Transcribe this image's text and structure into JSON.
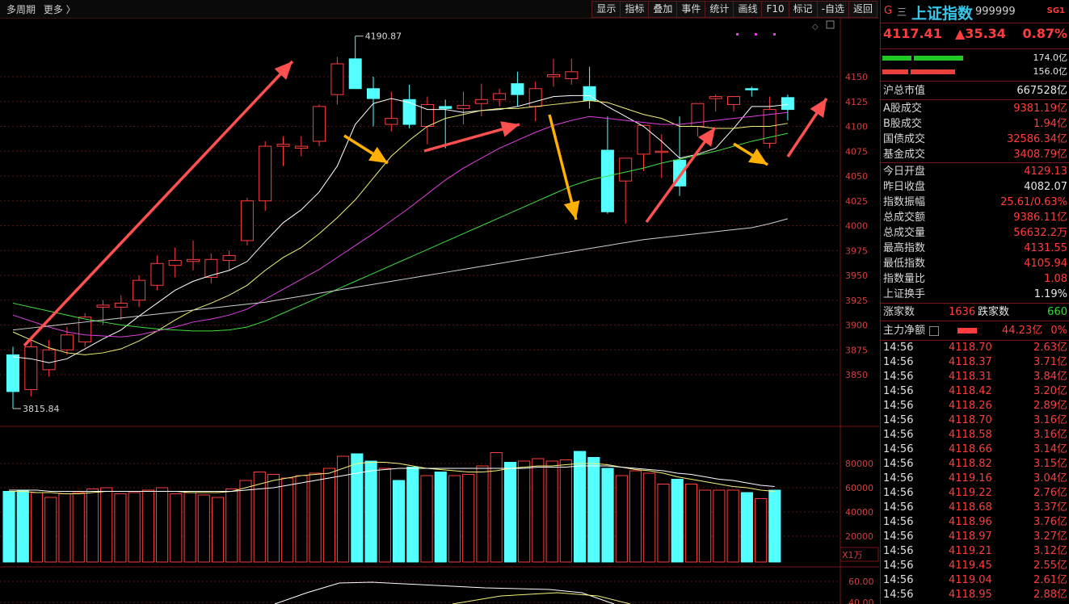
{
  "topbar": {
    "period": [
      "多周期",
      "更多 〉"
    ],
    "toolbar": [
      "显示",
      "指标",
      "叠加",
      "事件",
      "统计",
      "画线",
      "F10",
      "标记",
      "-自选",
      "返回"
    ]
  },
  "colors": {
    "up": "#ff3d3d",
    "down": "#54ffff",
    "ma5": "#ffffff",
    "ma10": "#f2f27a",
    "ma20": "#e040e0",
    "ma60": "#40e040",
    "ma120": "#d0d0d0",
    "arrow_red": "#ff5050",
    "arrow_yellow": "#ffb000"
  },
  "chart_data": [
    {
      "type": "candlestick",
      "ylim": [
        3815,
        4210
      ],
      "yticks": [
        3850,
        3875,
        3900,
        3925,
        3950,
        3975,
        4000,
        4025,
        4050,
        4075,
        4100,
        4125,
        4150
      ],
      "annotations": [
        {
          "label": "4190.87",
          "value": 4190.87,
          "bar": 19
        },
        {
          "label": "3815.84",
          "value": 3815.84,
          "bar": 0
        }
      ],
      "candles": [
        {
          "o": 3870,
          "h": 3878,
          "l": 3815.84,
          "c": 3833
        },
        {
          "o": 3835,
          "h": 3888,
          "l": 3828,
          "c": 3878
        },
        {
          "o": 3855,
          "h": 3885,
          "l": 3848,
          "c": 3875
        },
        {
          "o": 3875,
          "h": 3898,
          "l": 3870,
          "c": 3890
        },
        {
          "o": 3883,
          "h": 3912,
          "l": 3878,
          "c": 3908
        },
        {
          "o": 3918,
          "h": 3925,
          "l": 3900,
          "c": 3920
        },
        {
          "o": 3918,
          "h": 3930,
          "l": 3905,
          "c": 3922
        },
        {
          "o": 3925,
          "h": 3950,
          "l": 3918,
          "c": 3945
        },
        {
          "o": 3940,
          "h": 3970,
          "l": 3935,
          "c": 3962
        },
        {
          "o": 3960,
          "h": 3978,
          "l": 3948,
          "c": 3965
        },
        {
          "o": 3964,
          "h": 3985,
          "l": 3955,
          "c": 3966
        },
        {
          "o": 3948,
          "h": 3972,
          "l": 3942,
          "c": 3966
        },
        {
          "o": 3965,
          "h": 3975,
          "l": 3955,
          "c": 3970
        },
        {
          "o": 3985,
          "h": 4028,
          "l": 3980,
          "c": 4025
        },
        {
          "o": 4025,
          "h": 4085,
          "l": 4015,
          "c": 4080
        },
        {
          "o": 4080,
          "h": 4090,
          "l": 4060,
          "c": 4082
        },
        {
          "o": 4078,
          "h": 4090,
          "l": 4070,
          "c": 4080
        },
        {
          "o": 4085,
          "h": 4122,
          "l": 4080,
          "c": 4120
        },
        {
          "o": 4132,
          "h": 4170,
          "l": 4122,
          "c": 4163
        },
        {
          "o": 4168,
          "h": 4190.87,
          "l": 4140,
          "c": 4138
        },
        {
          "o": 4138,
          "h": 4150,
          "l": 4100,
          "c": 4128
        },
        {
          "o": 4102,
          "h": 4135,
          "l": 4095,
          "c": 4108
        },
        {
          "o": 4127,
          "h": 4142,
          "l": 4098,
          "c": 4102
        },
        {
          "o": 4100,
          "h": 4130,
          "l": 4082,
          "c": 4122
        },
        {
          "o": 4120,
          "h": 4127,
          "l": 4078,
          "c": 4118
        },
        {
          "o": 4118,
          "h": 4135,
          "l": 4102,
          "c": 4121
        },
        {
          "o": 4123,
          "h": 4143,
          "l": 4110,
          "c": 4127
        },
        {
          "o": 4127,
          "h": 4138,
          "l": 4120,
          "c": 4133
        },
        {
          "o": 4143,
          "h": 4155,
          "l": 4120,
          "c": 4132
        },
        {
          "o": 4120,
          "h": 4145,
          "l": 4105,
          "c": 4138
        },
        {
          "o": 4150,
          "h": 4168,
          "l": 4140,
          "c": 4152
        },
        {
          "o": 4148,
          "h": 4168,
          "l": 4142,
          "c": 4155
        },
        {
          "o": 4140,
          "h": 4160,
          "l": 4118,
          "c": 4126
        },
        {
          "o": 4076,
          "h": 4110,
          "l": 4012,
          "c": 4014
        },
        {
          "o": 4045,
          "h": 4068,
          "l": 4002,
          "c": 4068
        },
        {
          "o": 4072,
          "h": 4098,
          "l": 4055,
          "c": 4101
        },
        {
          "o": 4075,
          "h": 4092,
          "l": 4048,
          "c": 4075
        },
        {
          "o": 4066,
          "h": 4110,
          "l": 4030,
          "c": 4040
        },
        {
          "o": 4100,
          "h": 4123,
          "l": 4090,
          "c": 4123
        },
        {
          "o": 4128,
          "h": 4132,
          "l": 4115,
          "c": 4130
        },
        {
          "o": 4122,
          "h": 4130,
          "l": 4115,
          "c": 4130
        },
        {
          "o": 4138,
          "h": 4140,
          "l": 4130,
          "c": 4137
        },
        {
          "o": 4083,
          "h": 4130,
          "l": 4078,
          "c": 4117
        },
        {
          "o": 4129,
          "h": 4132,
          "l": 4106,
          "c": 4117
        }
      ],
      "ma": {
        "ma5": [
          3868,
          3866,
          3862,
          3866,
          3876,
          3886,
          3895,
          3909,
          3922,
          3935,
          3944,
          3950,
          3955,
          3964,
          3984,
          4003,
          4016,
          4034,
          4060,
          4102,
          4123,
          4128,
          4124,
          4117,
          4117,
          4114,
          4116,
          4117,
          4120,
          4125,
          4130,
          4131,
          4131,
          4120,
          4110,
          4100,
          4085,
          4068,
          4072,
          4078,
          4098,
          4120,
          4120,
          4122
        ],
        "ma10": [
          3893,
          3885,
          3877,
          3872,
          3870,
          3872,
          3876,
          3884,
          3894,
          3905,
          3915,
          3922,
          3930,
          3940,
          3955,
          3968,
          3978,
          3992,
          4008,
          4026,
          4048,
          4070,
          4086,
          4100,
          4108,
          4112,
          4116,
          4118,
          4118,
          4120,
          4122,
          4124,
          4126,
          4124,
          4118,
          4112,
          4108,
          4100,
          4100,
          4098,
          4098,
          4100,
          4100,
          4103
        ],
        "ma20": [
          3910,
          3904,
          3898,
          3893,
          3890,
          3889,
          3888,
          3890,
          3894,
          3898,
          3903,
          3906,
          3910,
          3916,
          3926,
          3936,
          3946,
          3956,
          3968,
          3980,
          3992,
          4005,
          4018,
          4032,
          4046,
          4058,
          4068,
          4078,
          4086,
          4094,
          4101,
          4106,
          4110,
          4108,
          4106,
          4104,
          4102,
          4102,
          4104,
          4106,
          4108,
          4110,
          4112,
          4114
        ],
        "ma60": [
          3922,
          3918,
          3914,
          3910,
          3906,
          3903,
          3900,
          3898,
          3896,
          3895,
          3894,
          3894,
          3895,
          3898,
          3904,
          3912,
          3920,
          3928,
          3936,
          3944,
          3952,
          3960,
          3968,
          3976,
          3984,
          3992,
          4000,
          4008,
          4016,
          4024,
          4032,
          4040,
          4046,
          4050,
          4054,
          4058,
          4063,
          4067,
          4071,
          4075,
          4080,
          4085,
          4089,
          4093
        ],
        "ma120": [
          3895,
          3897,
          3899,
          3901,
          3903,
          3905,
          3907,
          3909,
          3911,
          3913,
          3915,
          3917,
          3919,
          3921,
          3923,
          3926,
          3929,
          3932,
          3935,
          3938,
          3941,
          3944,
          3947,
          3950,
          3953,
          3956,
          3959,
          3962,
          3965,
          3968,
          3971,
          3974,
          3977,
          3980,
          3983,
          3986,
          3988,
          3990,
          3992,
          3994,
          3996,
          3998,
          4002,
          4007
        ]
      }
    },
    {
      "type": "bar",
      "name": "volume",
      "unit": "X1万",
      "ylim": [
        0,
        100000
      ],
      "yticks": [
        20000,
        40000,
        60000,
        80000
      ],
      "values": [
        57000,
        58000,
        56000,
        52000,
        55000,
        56000,
        59000,
        60000,
        55000,
        56000,
        58000,
        60000,
        55000,
        56000,
        54000,
        52000,
        59000,
        66000,
        73000,
        71000,
        68000,
        70000,
        72000,
        76000,
        86000,
        88000,
        82000,
        76000,
        66000,
        77000,
        70000,
        73000,
        70000,
        71000,
        78000,
        89000,
        81000,
        82000,
        84000,
        82000,
        83000,
        90000,
        85000,
        76000,
        70000,
        74000,
        72000,
        63000,
        67000,
        63000,
        58000,
        58000,
        58000,
        56000,
        51000,
        58000
      ],
      "ma1": [
        57000,
        57000,
        56000,
        56000,
        55000,
        55000,
        56000,
        57000,
        57000,
        57000,
        57000,
        57000,
        57000,
        56000,
        56000,
        56000,
        57000,
        60000,
        63000,
        66000,
        68000,
        70000,
        71000,
        72000,
        76000,
        80000,
        81000,
        81000,
        80000,
        78000,
        76000,
        75000,
        74000,
        73000,
        73000,
        74000,
        76000,
        77000,
        78000,
        78000,
        79000,
        80000,
        80000,
        79000,
        77000,
        75000,
        74000,
        72000,
        69000,
        67000,
        65000,
        63000,
        61000,
        60000,
        58000,
        57000
      ],
      "ma2": [
        58000,
        58000,
        58000,
        57000,
        57000,
        57000,
        57000,
        57000,
        57000,
        57000,
        57000,
        57000,
        57000,
        57000,
        57000,
        57000,
        57000,
        58000,
        59000,
        60000,
        62000,
        64000,
        66000,
        68000,
        70000,
        72000,
        74000,
        75000,
        76000,
        76000,
        76000,
        76000,
        76000,
        76000,
        76000,
        76000,
        76000,
        76000,
        77000,
        77000,
        77000,
        78000,
        78000,
        78000,
        77000,
        76000,
        75000,
        74000,
        72000,
        71000,
        69000,
        67000,
        66000,
        64000,
        62000,
        61000
      ]
    },
    {
      "type": "line",
      "name": "indicator",
      "yticks": [
        40,
        60
      ],
      "tick_labels": [
        "40.00",
        "60.00"
      ]
    }
  ],
  "panel": {
    "header": {
      "flag": "G",
      "menu": "三",
      "name": "上证指数",
      "code": "999999",
      "badge": "SG1"
    },
    "quote": {
      "price": "4117.41",
      "change": "▲35.34",
      "pct": "0.87%"
    },
    "bars": [
      {
        "val": "174.0亿",
        "fill": 0.65
      },
      {
        "val": "156.0亿",
        "fill": 0.58
      }
    ],
    "market_value": {
      "label": "沪总市值",
      "val": "667528亿"
    },
    "volumes": [
      {
        "label": "A股成交",
        "val": "9381.19亿"
      },
      {
        "label": "B股成交",
        "val": "1.94亿"
      },
      {
        "label": "国债成交",
        "val": "32586.34亿"
      },
      {
        "label": "基金成交",
        "val": "3408.79亿"
      }
    ],
    "stats": [
      {
        "label": "今日开盘",
        "val": "4129.13",
        "cls": "red"
      },
      {
        "label": "昨日收盘",
        "val": "4082.07",
        "cls": "wht"
      },
      {
        "label": "指数振幅",
        "val": "25.61/0.63%",
        "cls": "red"
      },
      {
        "label": "总成交额",
        "val": "9386.11亿",
        "cls": "red"
      },
      {
        "label": "总成交量",
        "val": "56632.2万",
        "cls": "red"
      },
      {
        "label": "最高指数",
        "val": "4131.55",
        "cls": "red"
      },
      {
        "label": "最低指数",
        "val": "4105.94",
        "cls": "red"
      },
      {
        "label": "指数量比",
        "val": "1.08",
        "cls": "red"
      },
      {
        "label": "上证换手",
        "val": "1.19%",
        "cls": "wht"
      }
    ],
    "breadth": {
      "up_label": "涨家数",
      "up": "1636",
      "down_label": "跌家数",
      "down": "660"
    },
    "netflow": {
      "label": "主力净额",
      "val": "44.23亿",
      "pct": "0%"
    },
    "ticks": [
      {
        "t": "14:56",
        "p": "4118.70",
        "v": "2.63亿"
      },
      {
        "t": "14:56",
        "p": "4118.37",
        "v": "3.71亿"
      },
      {
        "t": "14:56",
        "p": "4118.31",
        "v": "3.84亿"
      },
      {
        "t": "14:56",
        "p": "4118.42",
        "v": "3.20亿"
      },
      {
        "t": "14:56",
        "p": "4118.26",
        "v": "2.89亿"
      },
      {
        "t": "14:56",
        "p": "4118.70",
        "v": "3.16亿"
      },
      {
        "t": "14:56",
        "p": "4118.58",
        "v": "3.16亿"
      },
      {
        "t": "14:56",
        "p": "4118.66",
        "v": "3.14亿"
      },
      {
        "t": "14:56",
        "p": "4118.82",
        "v": "3.15亿"
      },
      {
        "t": "14:56",
        "p": "4119.16",
        "v": "3.04亿"
      },
      {
        "t": "14:56",
        "p": "4119.22",
        "v": "2.76亿"
      },
      {
        "t": "14:56",
        "p": "4118.68",
        "v": "3.37亿"
      },
      {
        "t": "14:56",
        "p": "4118.96",
        "v": "3.76亿"
      },
      {
        "t": "14:56",
        "p": "4118.97",
        "v": "3.27亿"
      },
      {
        "t": "14:56",
        "p": "4119.21",
        "v": "3.12亿"
      },
      {
        "t": "14:56",
        "p": "4119.45",
        "v": "2.55亿"
      },
      {
        "t": "14:56",
        "p": "4119.04",
        "v": "2.61亿"
      },
      {
        "t": "14:56",
        "p": "4118.95",
        "v": "2.88亿"
      }
    ]
  }
}
